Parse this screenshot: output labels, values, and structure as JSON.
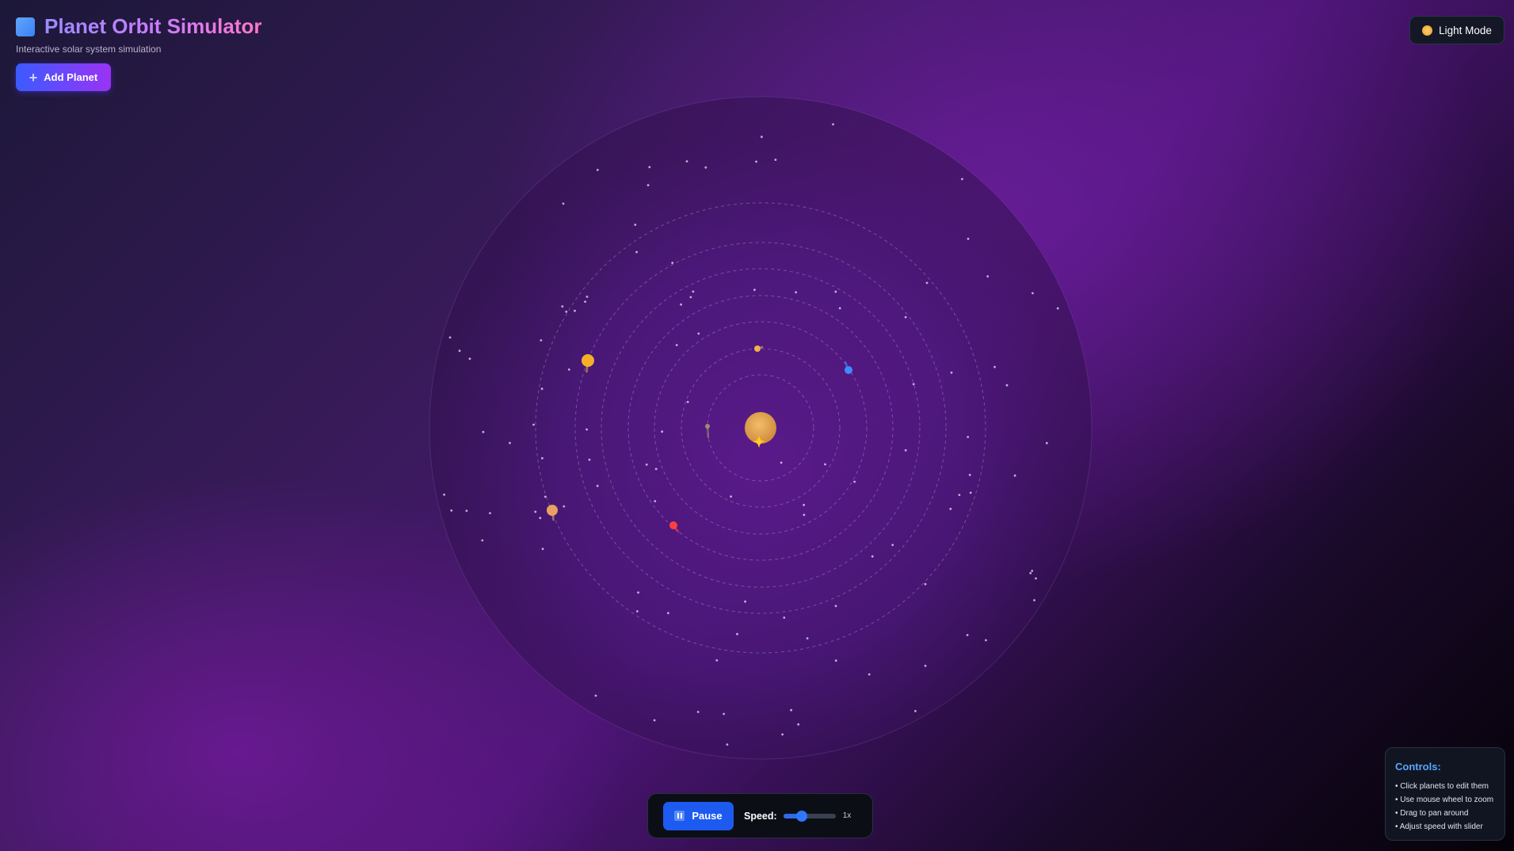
{
  "app": {
    "title": "Planet Orbit Simulator",
    "subtitle": "Interactive solar system simulation",
    "logo_icon": "blue-square-icon"
  },
  "toolbar": {
    "add_planet_label": "Add Planet",
    "add_icon": "plus-icon",
    "theme_toggle_label": "Light Mode",
    "theme_icon": "sun-icon"
  },
  "playback": {
    "pause_label": "Pause",
    "pause_icon": "pause-icon",
    "speed_label": "Speed:",
    "speed_value": "1x",
    "speed_slider_fraction": 0.35
  },
  "help": {
    "title": "Controls:",
    "items": [
      "• Click planets to edit them",
      "• Use mouse wheel to zoom",
      "• Drag to pan around",
      "• Adjust speed with slider"
    ]
  },
  "colors": {
    "accent_blue": "#1d5af0",
    "title_gradient_start": "#9b8cff",
    "title_gradient_end": "#ff77c8",
    "sun": "#e0a050",
    "help_title": "#58a6ff"
  },
  "simulation": {
    "sun_icon": "sun",
    "orbit_count": 8,
    "planets": [
      {
        "name": "planet-1",
        "color": "#9a8f70",
        "icon": "small-olive-planet"
      },
      {
        "name": "planet-2",
        "color": "#f0b050",
        "icon": "orange-planet"
      },
      {
        "name": "planet-3",
        "color": "#3f8bff",
        "icon": "blue-planet"
      },
      {
        "name": "planet-4",
        "color": "#ff4040",
        "icon": "red-planet"
      },
      {
        "name": "planet-5",
        "color": "#f5b028",
        "icon": "gold-planet"
      },
      {
        "name": "planet-6",
        "color": "#eaa060",
        "icon": "tan-planet"
      }
    ]
  }
}
